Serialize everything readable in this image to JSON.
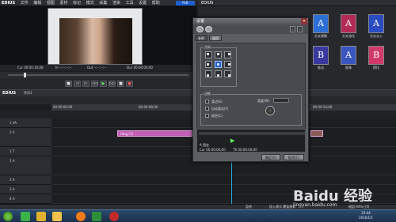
{
  "app": {
    "menu": [
      "文件",
      "编辑",
      "视图",
      "素材",
      "标记",
      "模式",
      "采集",
      "渲染",
      "工具",
      "设置",
      "帮助"
    ],
    "mode_badge": "PLR",
    "timeline_logo": "EDIUS"
  },
  "player": {
    "tc_cur": "Cur 00:00:10;08",
    "tc_in": "In --:--:--;--",
    "tc_out": "Out --:--:--;--",
    "tc_dur": "Dur 00:00:00;00",
    "buttons": [
      "■",
      "◁",
      "▷",
      "◁◁",
      "▶",
      "▷▷",
      "■",
      "●"
    ]
  },
  "effects_palette": {
    "items": [
      {
        "label": "交叉模糊",
        "color": "#2e6fd6",
        "letter": "A"
      },
      {
        "label": "交叉溶化",
        "color": "#b22a55",
        "letter": "A"
      },
      {
        "label": "交叉淡入",
        "color": "#2a4cc0",
        "letter": "A"
      },
      {
        "label": "推动",
        "color": "#3a3a9e",
        "letter": "B"
      },
      {
        "label": "推像",
        "color": "#3b55c0",
        "letter": "A"
      },
      {
        "label": "擦拭",
        "color": "#d03a6a",
        "letter": "B"
      }
    ]
  },
  "timeline": {
    "sequence_tab": "序列1",
    "ruler_labels": [
      "00:00:00;00",
      "00:00:08;00",
      "00:00:16;00",
      "00:00:24;00"
    ],
    "tracks": [
      "1 VA",
      "2 V",
      "1 T",
      "1 A",
      "2 A",
      "3 A",
      "4 A"
    ],
    "clip_label": "timg (1)",
    "status_left": "暂停",
    "status_right": "插入模式  覆盖模式",
    "disk": "磁盘:94%已用"
  },
  "dialog": {
    "title": "设置",
    "tabs": [
      "参数",
      "选项"
    ],
    "position_group": "方向",
    "border_group": "边框",
    "checkbox_1": "柔边(S)",
    "checkbox_2": "自动柔化(F)",
    "checkbox_3": "颜色(C)",
    "width_label": "宽度(W)",
    "tc_cur": "Cur 00:00:00;00",
    "tc_ttl": "Ttl 00:00:00;00",
    "ok": "确定(O)",
    "cancel": "取消(C)",
    "track_label": "A 固定"
  },
  "taskbar": {
    "time": "23:44",
    "date": "2016/1/1",
    "watermark": "Baidu 经验",
    "watermark_url": "jingyan.baidu.com"
  }
}
